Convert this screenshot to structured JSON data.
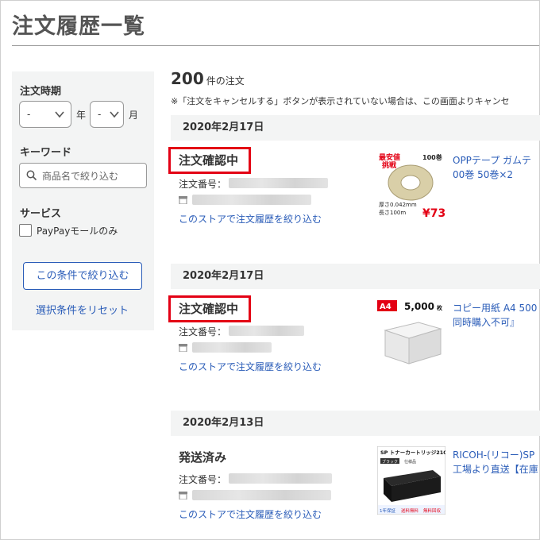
{
  "page_title": "注文履歴一覧",
  "sidebar": {
    "order_period_label": "注文時期",
    "year_select_value": "-",
    "year_unit": "年",
    "month_select_value": "-",
    "month_unit": "月",
    "keyword_label": "キーワード",
    "keyword_placeholder": "商品名で絞り込む",
    "service_label": "サービス",
    "paypay_checkbox_label": "PayPayモールのみ",
    "filter_button": "この条件で絞り込む",
    "reset_link": "選択条件をリセット"
  },
  "summary": {
    "count": "200",
    "count_suffix": "件の注文",
    "notice": "※「注文をキャンセルする」ボタンが表示されていない場合は、この画面よりキャンセ"
  },
  "orders": [
    {
      "date": "2020年2月17日",
      "status": "注文確認中",
      "highlighted": true,
      "order_number_label": "注文番号：",
      "store_filter_link": "このストアで注文履歴を絞り込む",
      "product_title_line1": "OPPテープ ガムテ",
      "product_title_line2": "00巻 50巻×2",
      "thumb_badge_top": "最安値",
      "thumb_badge_bottom": "挑戦",
      "thumb_count": "100巻",
      "thumb_spec_line1": "厚さ0.042mm",
      "thumb_spec_line2": "長さ100m",
      "thumb_price": "¥73"
    },
    {
      "date": "2020年2月17日",
      "status": "注文確認中",
      "highlighted": true,
      "order_number_label": "注文番号：",
      "store_filter_link": "このストアで注文履歴を絞り込む",
      "product_title_line1": "コピー用紙 A4 500",
      "product_title_line2": "同時購入不可』",
      "thumb_badge": "A4",
      "thumb_count": "5,000",
      "thumb_count_unit": "枚"
    },
    {
      "date": "2020年2月13日",
      "status": "発送済み",
      "highlighted": false,
      "order_number_label": "注文番号：",
      "store_filter_link": "このストアで注文履歴を絞り込む",
      "product_title_line1": "RICOH-(リコー)SP",
      "product_title_line2": "工場より直送【在庫",
      "thumb_header": "SP トナーカートリッジ2100H",
      "thumb_tag1": "ブラック",
      "thumb_tag2": "仕様品",
      "thumb_tag3": "1年保証",
      "thumb_tag4": "送料無料",
      "thumb_tag5": "無料回収"
    }
  ],
  "colors": {
    "link_blue": "#2a5cb8",
    "highlight_red": "#e30014",
    "panel_gray": "#f3f4f4"
  }
}
